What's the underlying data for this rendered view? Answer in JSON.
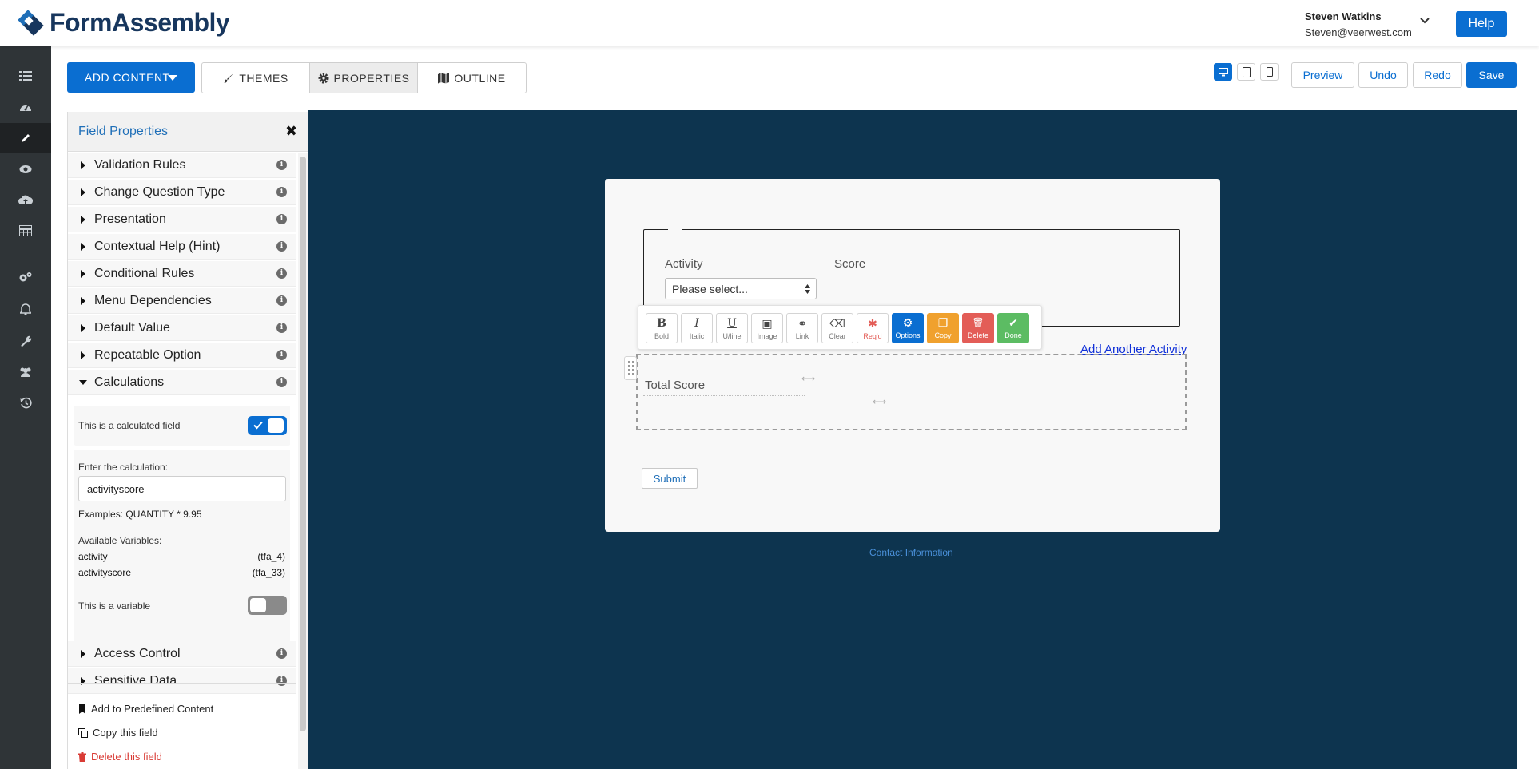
{
  "brand": {
    "name": "FormAssembly",
    "colors": {
      "primary": "#0a6ed1",
      "canvas": "#0d344f",
      "logo": "#17365d"
    }
  },
  "user": {
    "name": "Steven Watkins",
    "email": "Steven@veerwest.com"
  },
  "header": {
    "help_label": "Help"
  },
  "rail": {
    "items": [
      "list-icon",
      "dashboard-icon",
      "pencil-icon",
      "eye-icon",
      "cloud-upload-icon",
      "table-icon",
      "gears-icon",
      "bell-icon",
      "wrench-icon",
      "users-icon",
      "history-icon"
    ],
    "active": "pencil-icon"
  },
  "toolbar": {
    "add_content_label": "ADD CONTENT",
    "tabs": [
      {
        "label": "THEMES",
        "icon": "brush-icon"
      },
      {
        "label": "PROPERTIES",
        "icon": "gear-icon",
        "active": true
      },
      {
        "label": "OUTLINE",
        "icon": "map-icon"
      }
    ],
    "devices": [
      "desktop-icon",
      "tablet-icon",
      "phone-icon"
    ],
    "active_device": "desktop-icon",
    "preview_label": "Preview",
    "undo_label": "Undo",
    "redo_label": "Redo",
    "save_label": "Save"
  },
  "panel": {
    "title": "Field Properties",
    "close_glyph": "✖",
    "sections": [
      "Validation Rules",
      "Change Question Type",
      "Presentation",
      "Contextual Help (Hint)",
      "Conditional Rules",
      "Menu Dependencies",
      "Default Value",
      "Repeatable Option",
      "Calculations"
    ],
    "expanded_section": "Calculations",
    "calculations": {
      "calculated_label": "This is a calculated field",
      "calculated_on": true,
      "enter_label": "Enter the calculation:",
      "calculation_value": "activityscore",
      "examples": "Examples: QUANTITY * 9.95",
      "variables_label": "Available Variables:",
      "variables": [
        {
          "name": "activity",
          "id": "(tfa_4)"
        },
        {
          "name": "activityscore",
          "id": "(tfa_33)"
        }
      ],
      "variable_label": "This is a variable",
      "variable_on": false
    },
    "sections_after": [
      "Access Control",
      "Sensitive Data"
    ],
    "footer": {
      "add_predefined": "Add to Predefined Content",
      "copy_field": "Copy this field",
      "delete_field": "Delete this field"
    },
    "info_glyph": "i"
  },
  "form": {
    "activity_label": "Activity",
    "score_label": "Score",
    "select_placeholder": "Please select...",
    "add_another": "Add Another Activity",
    "total_score_label": "Total Score",
    "submit_label": "Submit",
    "contact_link": "Contact Information",
    "resize_glyph": "⟷"
  },
  "editor_toolbar": {
    "buttons": [
      {
        "label": "Bold",
        "glyph": "B",
        "icon": "bold-icon"
      },
      {
        "label": "Italic",
        "glyph": "I",
        "icon": "italic-icon"
      },
      {
        "label": "U/line",
        "glyph": "U",
        "icon": "underline-icon"
      },
      {
        "label": "Image",
        "glyph": "▣",
        "icon": "image-icon"
      },
      {
        "label": "Link",
        "glyph": "⚭",
        "icon": "link-icon"
      },
      {
        "label": "Clear",
        "glyph": "⌫",
        "icon": "eraser-icon"
      },
      {
        "label": "Req'd",
        "glyph": "✱",
        "icon": "asterisk-icon"
      },
      {
        "label": "Options",
        "glyph": "⚙",
        "icon": "gear-icon",
        "color": "#0a6ed1"
      },
      {
        "label": "Copy",
        "glyph": "❐",
        "icon": "copy-icon",
        "color": "#f0a12e"
      },
      {
        "label": "Delete",
        "glyph": "🗑",
        "icon": "trash-icon",
        "color": "#e35d57"
      },
      {
        "label": "Done",
        "glyph": "✔",
        "icon": "check-icon",
        "color": "#5cbc63"
      }
    ]
  }
}
